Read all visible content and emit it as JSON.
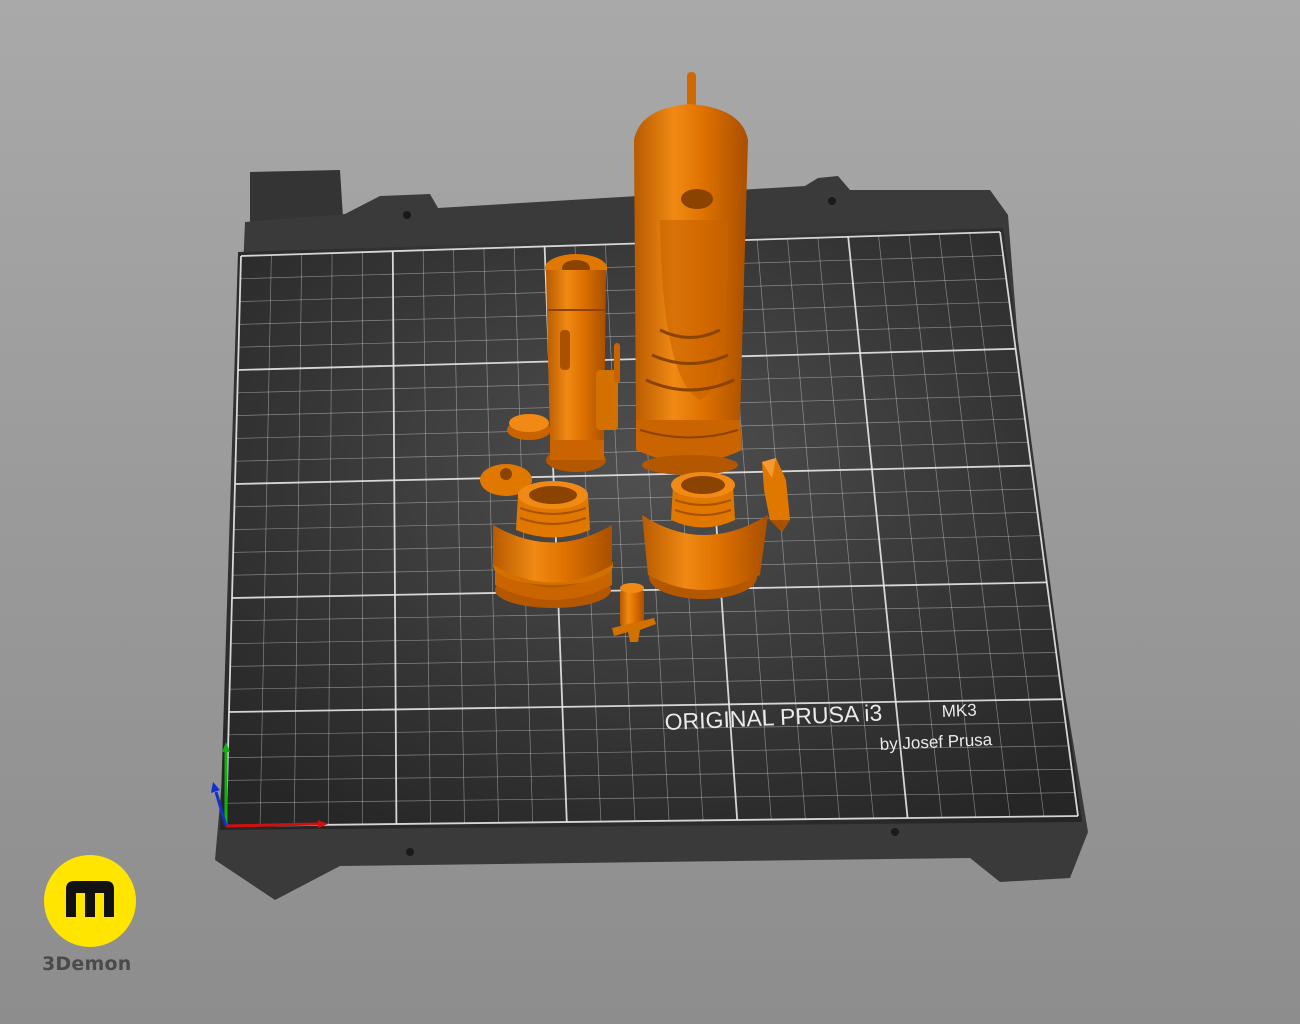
{
  "viewport": {
    "background_top": "#a9a9a9",
    "background_bottom": "#8d8d8d"
  },
  "bed": {
    "frame_color": "#3a3a3a",
    "sheet_color": "#2b2b2b",
    "grid_color": "#e8e8e8",
    "label_main": "ORIGINAL PRUSA i3",
    "label_model": "MK3",
    "label_author": "by Josef Prusa"
  },
  "model": {
    "color": "#e07200",
    "parts": [
      "long-handle",
      "short-handle",
      "ring-left",
      "ring-right",
      "small-cap",
      "small-disc",
      "crystal",
      "small-connector"
    ]
  },
  "axes": {
    "x_color": "#d01010",
    "y_color": "#10b010",
    "z_color": "#1030d0"
  },
  "brand": {
    "name": "3Demon",
    "badge_color": "#ffe500"
  }
}
